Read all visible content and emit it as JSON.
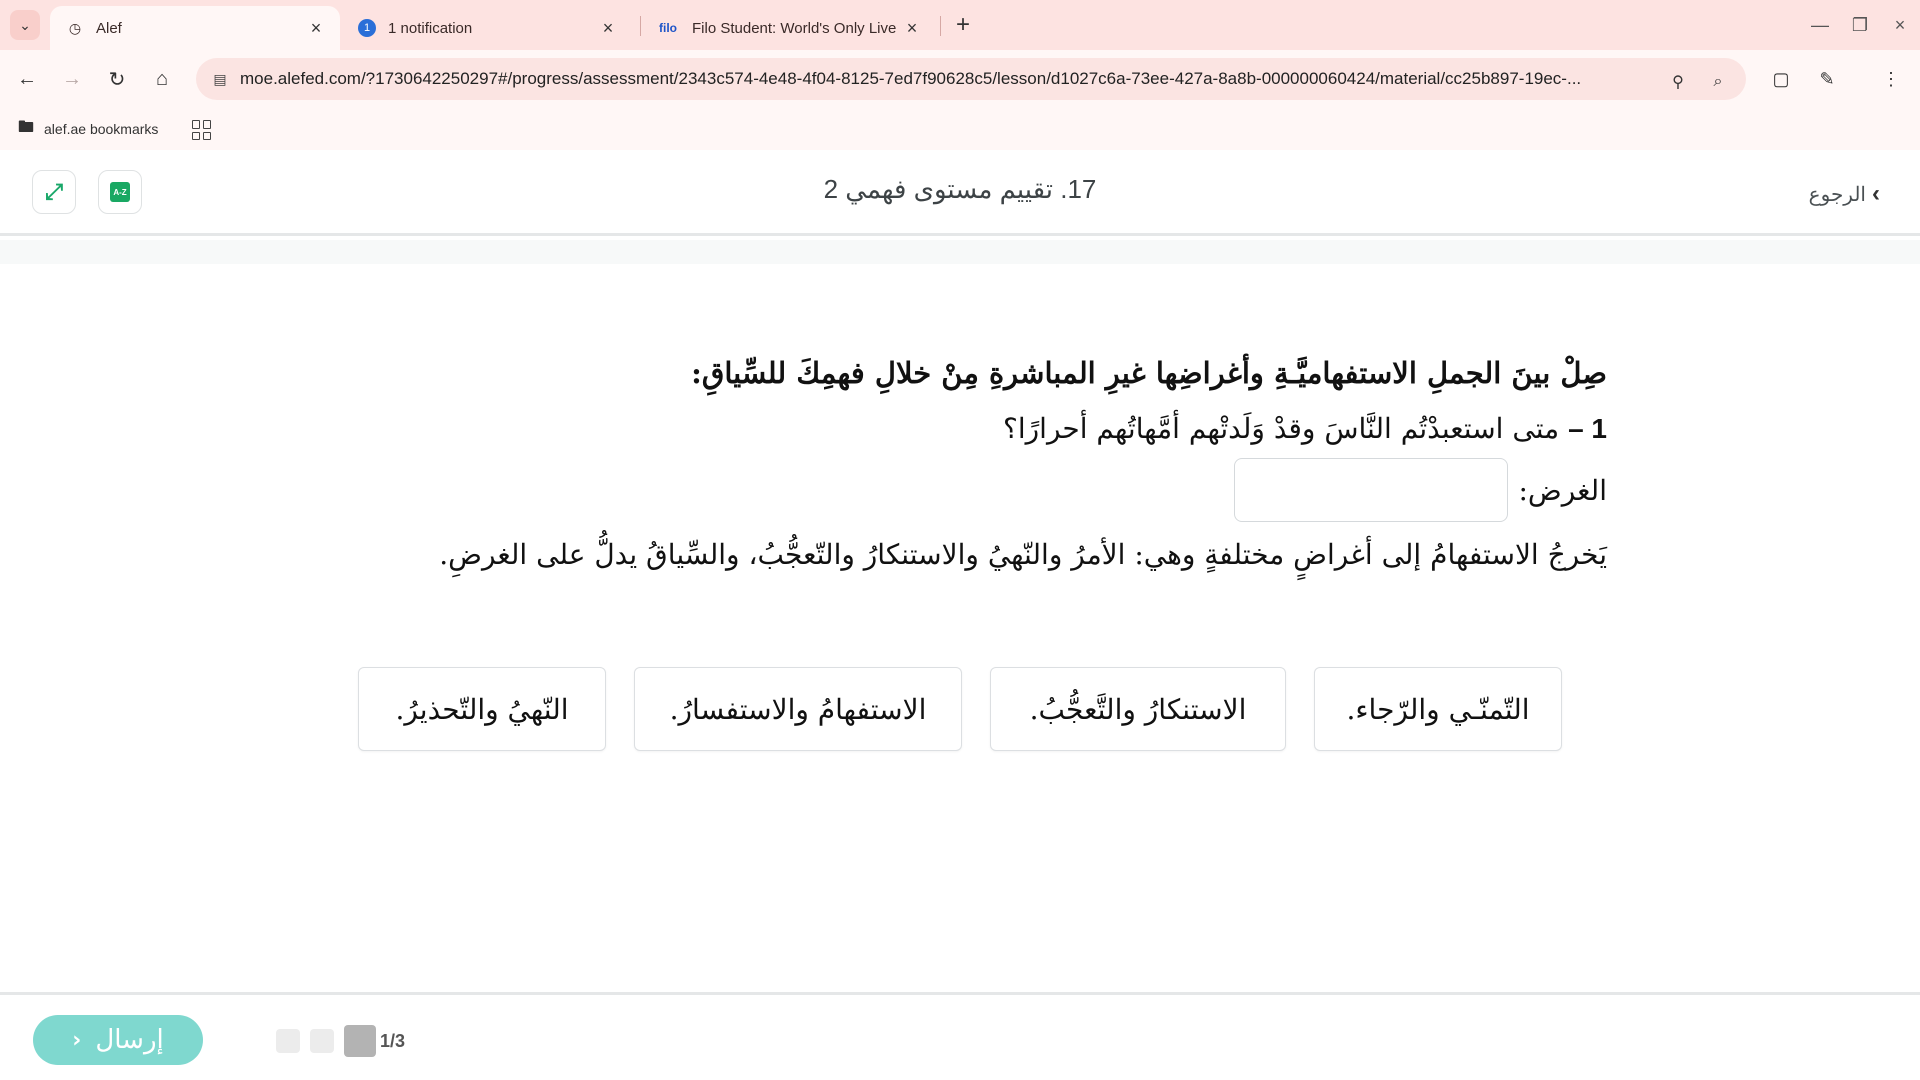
{
  "browser": {
    "tabs": [
      {
        "title": "Alef",
        "icon": "alef-logo-icon"
      },
      {
        "title": "1 notification",
        "badge": "1"
      },
      {
        "title": "Filo Student: World's Only Live I",
        "logo_text": "filo"
      }
    ],
    "url": "moe.alefed.com/?1730642250297#/progress/assessment/2343c574-4e48-4f04-8125-7ed7f90628c5/lesson/d1027c6a-73ee-427a-8a8b-000000060424/material/cc25b897-19ec-...",
    "bookmarks": [
      {
        "label": "alef.ae bookmarks"
      }
    ],
    "accent_color": "#fde3e1"
  },
  "header": {
    "title": "17. تقييم مستوى فهمي 2",
    "back_label": "الرجوع",
    "dictionary_icon_text": "A-Z"
  },
  "question": {
    "instruction": "صِلْ بينَ الجملِ الاستفهاميَّـةِ وأغراضِها غيرِ المباشرةِ مِنْ خلالِ فهمِكَ للسِّياقِ:",
    "number": "1 –",
    "sentence": "متى استعبدْتُم النَّاسَ وقدْ وَلَدتْهم أمَّهاتُهم أحرارًا؟",
    "purpose_label": "الغرض:",
    "purpose_value": "",
    "note": "يَخرجُ الاستفهامُ إلى أغراضٍ مختلفةٍ وهي: الأمرُ والنّهيُ والاستنكارُ والتّعجُّبُ، والسِّياقُ يدلُّ على الغرضِ."
  },
  "options": [
    "التّمنّـي والرّجاء.",
    "الاستنكارُ والتَّعجُّبُ.",
    "الاستفهامُ والاستفسارُ.",
    "النّهيُ والتّحذيرُ."
  ],
  "footer": {
    "submit_label": "إرسال",
    "pager_label": "1/3",
    "submit_color": "#7fd8cf"
  }
}
